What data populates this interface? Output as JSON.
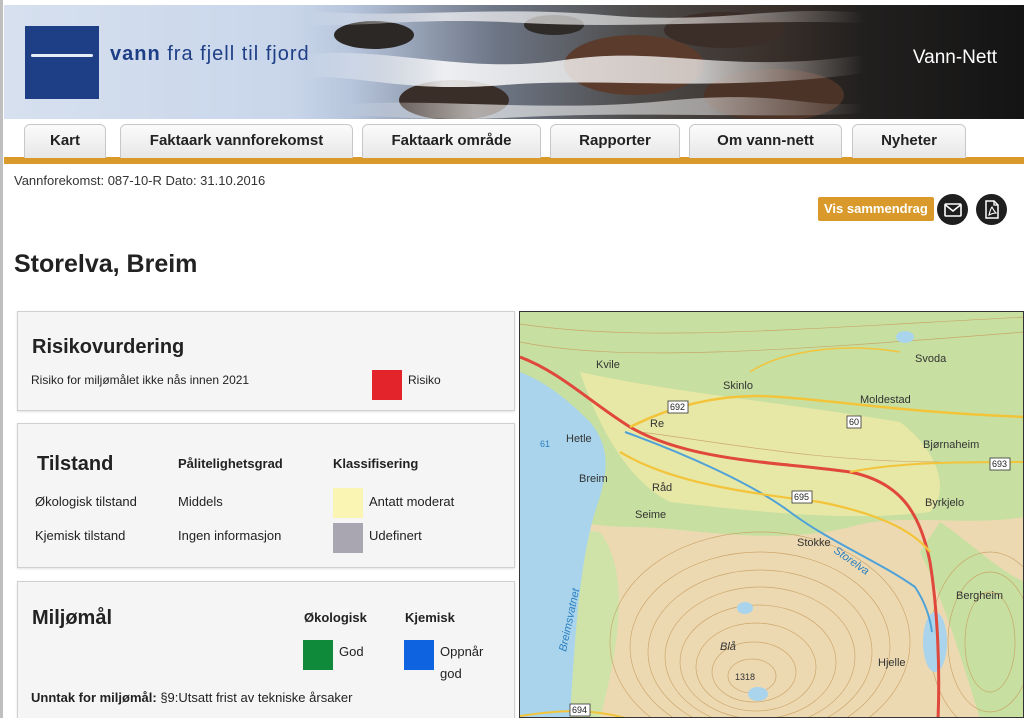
{
  "header": {
    "tagline_word1": "vann",
    "tagline_rest": "fra fjell til fjord",
    "site_name": "Vann-Nett"
  },
  "tabs": [
    {
      "label": "Kart"
    },
    {
      "label": "Faktaark vannforekomst"
    },
    {
      "label": "Faktaark område"
    },
    {
      "label": "Rapporter"
    },
    {
      "label": "Om vann-nett"
    },
    {
      "label": "Nyheter"
    }
  ],
  "meta": {
    "line": "Vannforekomst: 087-10-R Dato: 31.10.2016"
  },
  "actions": {
    "summary_label": "Vis sammendrag",
    "email_icon": "envelope-icon",
    "pdf_icon": "pdf-icon"
  },
  "page": {
    "title": "Storelva, Breim"
  },
  "risk": {
    "heading": "Risikovurdering",
    "text": "Risiko for miljømålet ikke nås innen 2021",
    "status": "Risiko",
    "status_color": "#e3242b"
  },
  "condition": {
    "heading": "Tilstand",
    "col_reliability": "Pålitelighetsgrad",
    "col_class": "Klassifisering",
    "rows": [
      {
        "label": "Økologisk tilstand",
        "reliability": "Middels",
        "class": "Antatt moderat",
        "color": "#fbf5b4"
      },
      {
        "label": "Kjemisk tilstand",
        "reliability": "Ingen informasjon",
        "class": "Udefinert",
        "color": "#a9a6b2"
      }
    ]
  },
  "goals": {
    "heading": "Miljømål",
    "col_ecological": "Økologisk",
    "col_chemical": "Kjemisk",
    "ecological_value": "God",
    "ecological_color": "#0f8a3b",
    "chemical_value_line1": "Oppnår",
    "chemical_value_line2": "god",
    "chemical_color": "#0d63e0",
    "exception_label": "Unntak for miljømål:",
    "exception_value": "§9:Utsatt frist av tekniske årsaker"
  },
  "map": {
    "places": [
      "Kvile",
      "Skinlo",
      "Svoda",
      "Moldestad",
      "Re",
      "Hetle",
      "Bjørnaheim",
      "Breim",
      "Råd",
      "Byrkjelo",
      "Seime",
      "Stokke",
      "Storelva",
      "Bergheim",
      "Breimsvatnet",
      "Hjelle",
      "Blå"
    ],
    "road_numbers": [
      "692",
      "60",
      "693",
      "695",
      "694"
    ],
    "elevations": [
      "61",
      "1318"
    ]
  }
}
